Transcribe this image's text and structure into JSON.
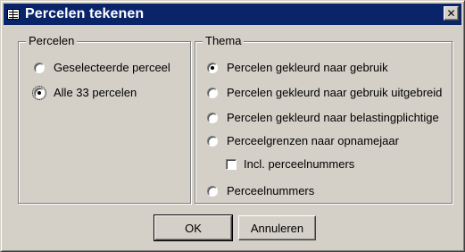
{
  "window": {
    "title": "Percelen tekenen",
    "close_label": "✕"
  },
  "percelen_group": {
    "label": "Percelen",
    "options": [
      {
        "label": "Geselecteerde perceel",
        "selected": false
      },
      {
        "label": "Alle 33 percelen",
        "selected": true
      }
    ]
  },
  "thema_group": {
    "label": "Thema",
    "options": [
      {
        "label": "Percelen gekleurd naar gebruik",
        "selected": true
      },
      {
        "label": "Percelen gekleurd naar gebruik uitgebreid",
        "selected": false
      },
      {
        "label": "Percelen gekleurd naar belastingplichtige",
        "selected": false
      },
      {
        "label": "Perceelgrenzen naar opnamejaar",
        "selected": false
      },
      {
        "label": "Perceelnummers",
        "selected": false
      }
    ],
    "checkbox": {
      "label": "Incl. perceelnummers",
      "checked": false
    }
  },
  "buttons": {
    "ok_label": "OK",
    "cancel_label": "Annuleren"
  }
}
